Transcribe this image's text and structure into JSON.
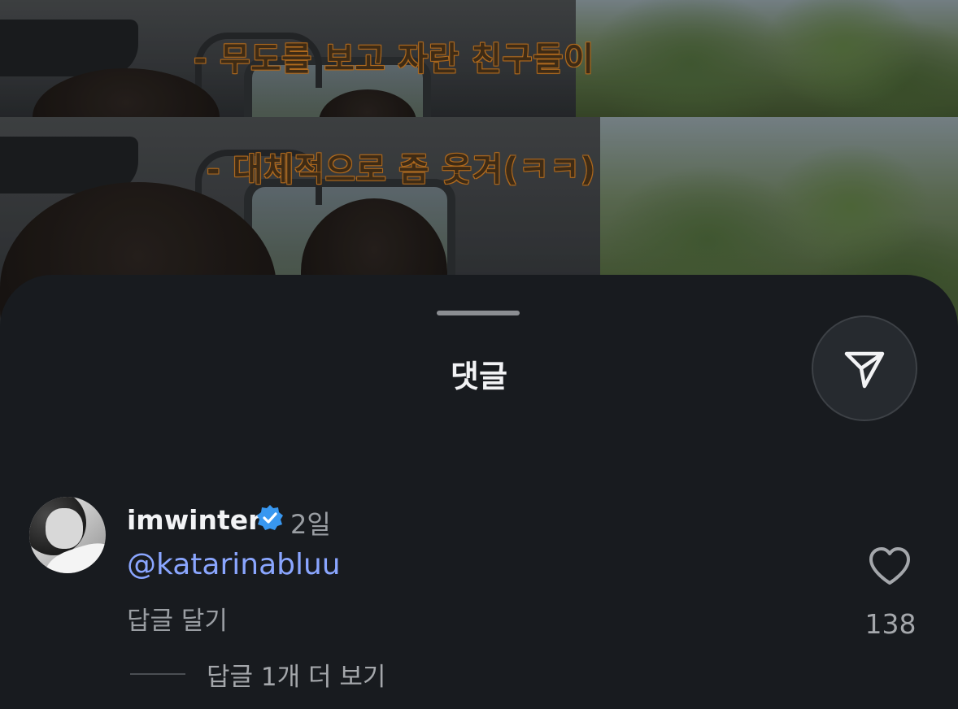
{
  "video": {
    "subtitles": [
      "- 무도를 보고 자란 친구들이",
      "- 대체적으로 좀 웃겨(ㅋㅋ)"
    ]
  },
  "comments_sheet": {
    "title": "댓글",
    "share_icon": "send-icon",
    "comment": {
      "username": "imwinter",
      "verified": true,
      "verified_icon": "verified-badge-icon",
      "timestamp": "2일",
      "text": "@katarinabluu",
      "reply_label": "답글 달기",
      "like_icon": "heart-icon",
      "like_count": "138",
      "view_replies_label": "답글 1개 더 보기"
    }
  },
  "colors": {
    "sheet_background": "#181b1f",
    "mention": "#8aa6ff",
    "verified": "#3897f0",
    "secondary_text": "#9a9ea3"
  }
}
